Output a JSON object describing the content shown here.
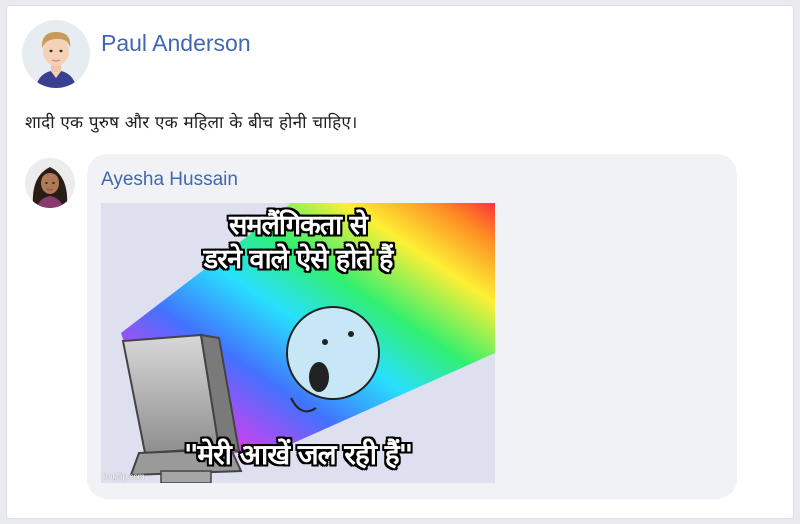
{
  "post": {
    "author": "Paul Anderson",
    "text": "शादी एक पुरुष और एक महिला के बीच होनी चाहिए।"
  },
  "comment": {
    "author": "Ayesha Hussain",
    "meme": {
      "caption_line1": "समलैंगिकता से",
      "caption_line2": "डरने वाले ऐसे होते हैं",
      "caption_bottom": "\"मेरी आखें जल रही हैं\"",
      "watermark": "imgflip.com"
    }
  },
  "colors": {
    "link": "#4267b2",
    "bubble": "#f0f2f5",
    "background": "#e9ebee"
  }
}
